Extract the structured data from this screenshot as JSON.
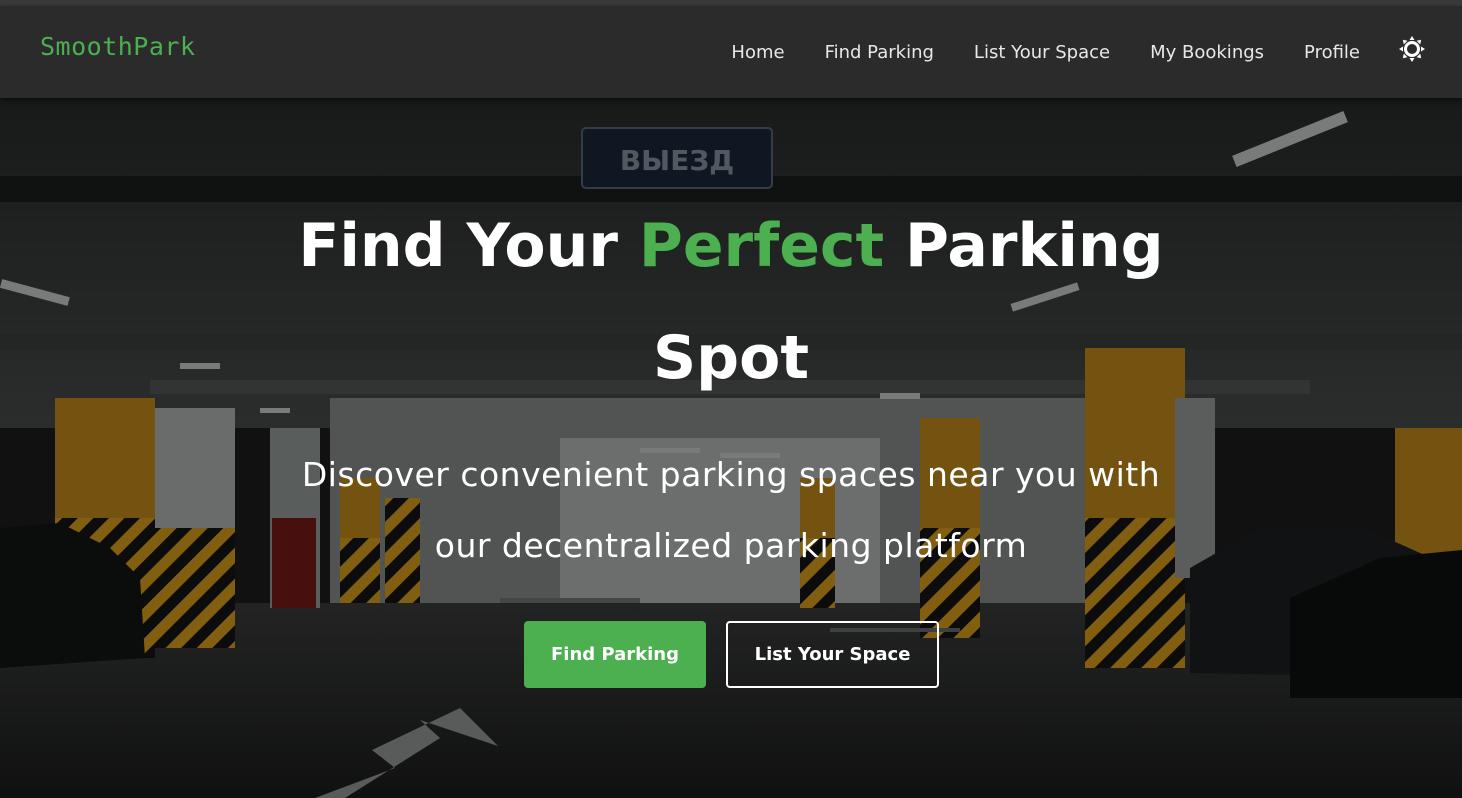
{
  "brand": {
    "name": "SmoothPark",
    "color": "#4caf50"
  },
  "nav": {
    "items": [
      {
        "label": "Home"
      },
      {
        "label": "Find Parking"
      },
      {
        "label": "List Your Space"
      },
      {
        "label": "My Bookings"
      },
      {
        "label": "Profile"
      }
    ],
    "theme_icon": "sun-icon"
  },
  "hero": {
    "title_before": "Find Your ",
    "title_accent": "Perfect",
    "title_after": " Parking Spot",
    "subtitle": "Discover convenient parking spaces near you with our decentralized parking platform",
    "sign_text": "ВЫЕЗД",
    "primary_button": "Find Parking",
    "secondary_button": "List Your Space",
    "background_image": "underground-parking-garage"
  },
  "colors": {
    "accent": "#4caf50",
    "navbar": "#2b2b2b",
    "text": "#ffffff"
  }
}
